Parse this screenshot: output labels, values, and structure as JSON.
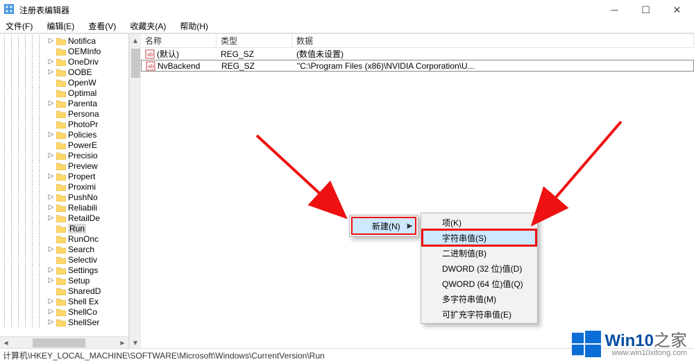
{
  "window": {
    "title": "注册表编辑器"
  },
  "menu": {
    "file": "文件(F)",
    "edit": "编辑(E)",
    "view": "查看(V)",
    "favorites": "收藏夹(A)",
    "help": "帮助(H)"
  },
  "tree": {
    "items": [
      {
        "label": "Notifica",
        "exp": ">"
      },
      {
        "label": "OEMInfo",
        "exp": ""
      },
      {
        "label": "OneDriv",
        "exp": ">"
      },
      {
        "label": "OOBE",
        "exp": ">"
      },
      {
        "label": "OpenW",
        "exp": ""
      },
      {
        "label": "Optimal",
        "exp": ""
      },
      {
        "label": "Parenta",
        "exp": ">"
      },
      {
        "label": "Persona",
        "exp": ""
      },
      {
        "label": "PhotoPr",
        "exp": ""
      },
      {
        "label": "Policies",
        "exp": ">"
      },
      {
        "label": "PowerE",
        "exp": ""
      },
      {
        "label": "Precisio",
        "exp": ">"
      },
      {
        "label": "Preview",
        "exp": ""
      },
      {
        "label": "Propert",
        "exp": ">"
      },
      {
        "label": "Proximi",
        "exp": ""
      },
      {
        "label": "PushNo",
        "exp": ">"
      },
      {
        "label": "Reliabili",
        "exp": ">"
      },
      {
        "label": "RetailDe",
        "exp": ">"
      },
      {
        "label": "Run",
        "exp": "",
        "selected": true
      },
      {
        "label": "RunOnc",
        "exp": ""
      },
      {
        "label": "Search",
        "exp": ">"
      },
      {
        "label": "Selectiv",
        "exp": ""
      },
      {
        "label": "Settings",
        "exp": ">"
      },
      {
        "label": "Setup",
        "exp": ">"
      },
      {
        "label": "SharedD",
        "exp": ""
      },
      {
        "label": "Shell Ex",
        "exp": ">"
      },
      {
        "label": "ShellCo",
        "exp": ">"
      },
      {
        "label": "ShellSer",
        "exp": ">"
      }
    ]
  },
  "list": {
    "headers": {
      "name": "名称",
      "type": "类型",
      "data": "数据"
    },
    "rows": [
      {
        "name": "(默认)",
        "type": "REG_SZ",
        "data": "(数值未设置)",
        "boxed": false
      },
      {
        "name": "NvBackend",
        "type": "REG_SZ",
        "data": "\"C:\\Program Files (x86)\\NVIDIA Corporation\\U...",
        "boxed": true
      }
    ]
  },
  "statusbar": {
    "path": "计算机\\HKEY_LOCAL_MACHINE\\SOFTWARE\\Microsoft\\Windows\\CurrentVersion\\Run"
  },
  "context": {
    "new_label": "新建(N)",
    "submenu": [
      {
        "label": "项(K)",
        "hl": false
      },
      {
        "label": "字符串值(S)",
        "hl": true
      },
      {
        "label": "二进制值(B)",
        "hl": false
      },
      {
        "label": "DWORD (32 位)值(D)",
        "hl": false
      },
      {
        "label": "QWORD (64 位)值(Q)",
        "hl": false
      },
      {
        "label": "多字符串值(M)",
        "hl": false
      },
      {
        "label": "可扩充字符串值(E)",
        "hl": false
      }
    ]
  },
  "watermark": {
    "title_prefix": "Win10",
    "title_suffix": "之家",
    "url": "www.win10xitong.com"
  }
}
